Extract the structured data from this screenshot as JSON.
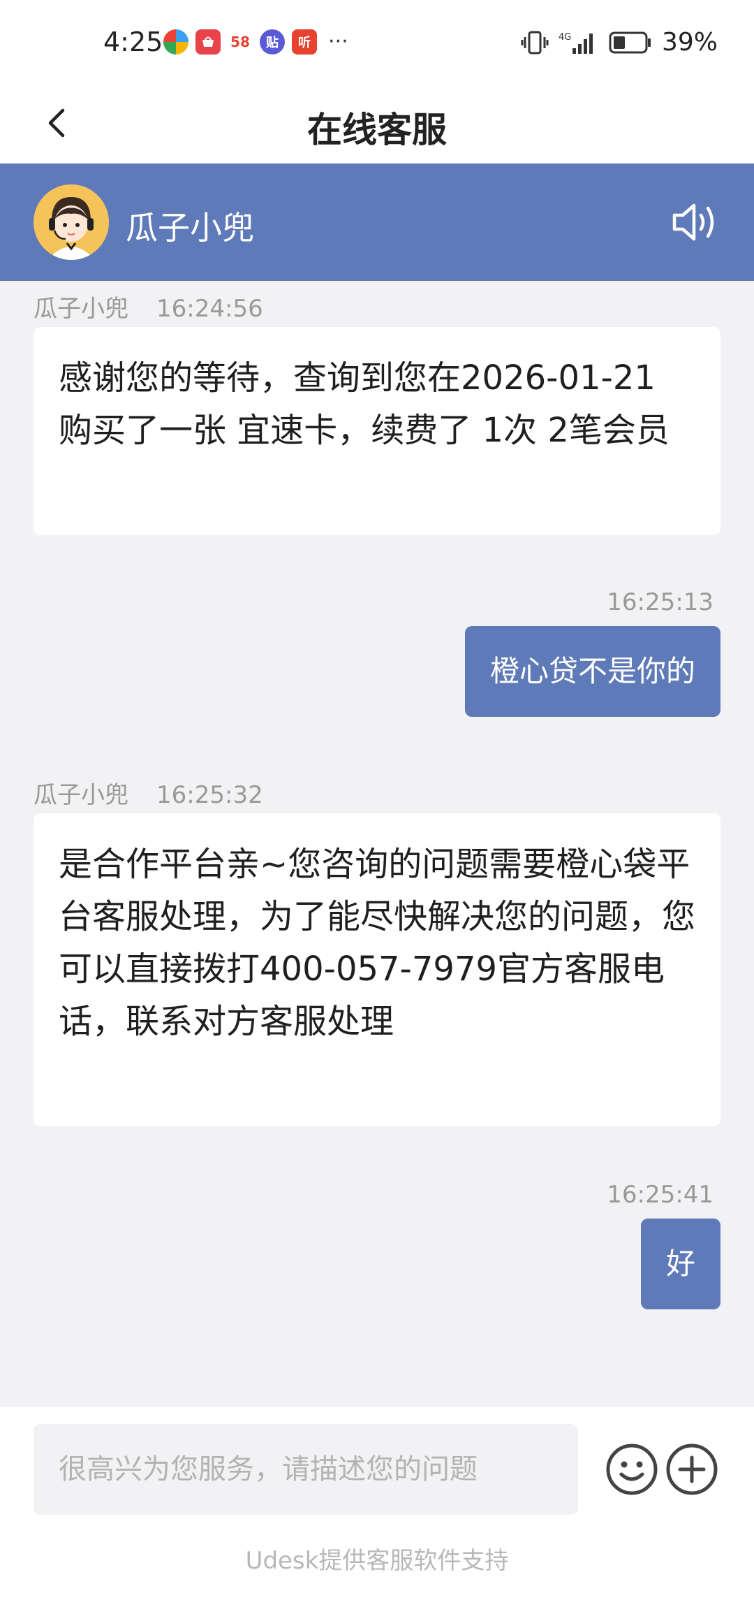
{
  "status_bar": {
    "time": "4:25",
    "apps": [
      {
        "name": "app-icon-1",
        "label": "",
        "color": "#3aa0f0"
      },
      {
        "name": "huawei-store-icon",
        "label": "",
        "color": "#e8434a"
      },
      {
        "name": "58-app-icon",
        "label": "58",
        "color": "#ffffff"
      },
      {
        "name": "tieba-icon",
        "label": "贴",
        "color": "#5a5ad6"
      },
      {
        "name": "ting-app-icon",
        "label": "听",
        "color": "#e8412e"
      }
    ],
    "more": "···",
    "network": "4G",
    "battery_pct": "39%",
    "battery_level": 0.39
  },
  "title_bar": {
    "title": "在线客服"
  },
  "agent": {
    "name": "瓜子小兜"
  },
  "messages": [
    {
      "side": "left",
      "sender": "瓜子小兜",
      "time": "16:24:56",
      "text": "感谢您的等待，查询到您在2026-01-21 购买了一张 宜速卡，续费了 1次 2笔会员"
    },
    {
      "side": "right",
      "time": "16:25:13",
      "text": "橙心贷不是你的"
    },
    {
      "side": "left",
      "sender": "瓜子小兜",
      "time": "16:25:32",
      "text": "是合作平台亲~您咨询的问题需要橙心袋平台客服处理，为了能尽快解决您的问题，您可以直接拨打400-057-7979官方客服电话，联系对方客服处理"
    },
    {
      "side": "right",
      "time": "16:25:41",
      "text": "好"
    }
  ],
  "input": {
    "placeholder": "很高兴为您服务，请描述您的问题",
    "value": ""
  },
  "footer": {
    "powered_by": "Udesk提供客服软件支持"
  },
  "colors": {
    "brand": "#5f7ab8",
    "background": "#f2f2f4"
  }
}
